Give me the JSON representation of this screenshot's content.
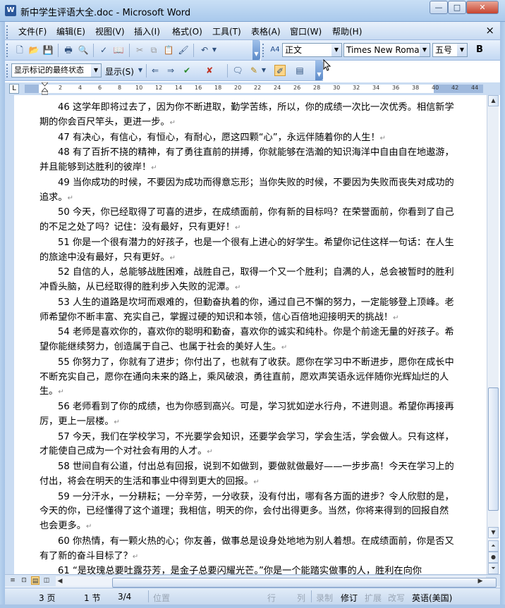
{
  "window": {
    "title": "新中学生评语大全.doc - Microsoft Word",
    "app_icon": "W",
    "minimize": "—",
    "maximize": "□",
    "close": "✕"
  },
  "menubar": {
    "items": [
      "文件(F)",
      "编辑(E)",
      "视图(V)",
      "插入(I)",
      "格式(O)",
      "工具(T)",
      "表格(A)",
      "窗口(W)",
      "帮助(H)"
    ],
    "close_doc": "×"
  },
  "toolbar_standard": {
    "icons": [
      "new-icon",
      "open-icon",
      "save-icon",
      "print-icon",
      "print-preview-icon",
      "spelling-icon",
      "research-icon",
      "cut-icon",
      "copy-icon",
      "paste-icon",
      "format-painter-icon",
      "undo-icon"
    ],
    "style_label_icon": "A4",
    "style_value": "正文",
    "font_value": "Times New Roman",
    "size_value": "五号",
    "bold": "B"
  },
  "toolbar_review": {
    "markup_value": "显示标记的最终状态",
    "show_label": "显示(S)"
  },
  "ruler": {
    "corner": "L",
    "ticks": [
      "2",
      "4",
      "6",
      "8",
      "10",
      "12",
      "14",
      "16",
      "18",
      "20",
      "22",
      "24",
      "26",
      "28",
      "30",
      "32",
      "34",
      "36",
      "38",
      "40",
      "42",
      "44"
    ]
  },
  "document": {
    "paragraphs": [
      "46 这学年即将过去了，因为你不断进取，勤学苦练，所以，你的成绩一次比一次优秀。相信新学期的你会百尺竿头，更进一步。",
      "47 有决心，有信心，有恒心，有耐心，愿这四颗“心”，永远伴随着你的人生！",
      "48 有了百折不挠的精神，有了勇往直前的拼搏，你就能够在浩瀚的知识海洋中自由自在地遨游，并且能够到达胜利的彼岸！",
      "49 当你成功的时候，不要因为成功而得意忘形；当你失败的时候，不要因为失败而丧失对成功的追求。",
      "50 今天，你已经取得了可喜的进步，在成绩面前，你有新的目标吗？在荣誉面前，你看到了自己的不足之处了吗？记住：没有最好，只有更好！",
      "51 你是一个很有潜力的好孩子，也是一个很有上进心的好学生。希望你记住这样一句话：在人生的旅途中没有最好，只有更好。",
      "52 自信的人，总能够战胜困难，战胜自己，取得一个又一个胜利；自满的人，总会被暂时的胜利冲昏头脑，从已经取得的胜利步入失败的泥潭。",
      "53 人生的道路是坎坷而艰难的，但勤奋执着的你，通过自己不懈的努力，一定能够登上顶峰。老师希望你不断丰富、充实自己，掌握过硬的知识和本领，信心百倍地迎接明天的挑战！",
      "54 老师是喜欢你的，喜欢你的聪明和勤奋，喜欢你的诚实和纯朴。你是个前途无量的好孩子。希望你能继续努力，创造属于自己、也属于社会的美好人生。",
      "55 你努力了，你就有了进步；你付出了，也就有了收获。愿你在学习中不断进步，愿你在成长中不断充实自己，愿你在通向未来的路上，乘风破浪，勇往直前，愿欢声笑语永远伴随你光辉灿烂的人生。",
      "56 老师看到了你的成绩，也为你感到高兴。可是，学习犹如逆水行舟，不进则退。希望你再接再厉，更上一层楼。",
      "57 今天，我们在学校学习，不光要学会知识，还要学会学习，学会生活，学会做人。只有这样，才能使自己成为一个对社会有用的人才。",
      "58 世间自有公道，付出总有回报，说到不如做到，要做就做最好——一步步高！今天在学习上的付出，将会在明天的生活和事业中得到更大的回报。",
      "59 一分汗水，一分耕耘；一分辛劳，一分收获，没有付出，哪有各方面的进步？令人欣慰的是，今天的你，已经懂得了这个道理；我相信，明天的你，会付出得更多。当然，你将来得到的回报自然也会更多。",
      "60 你热情，有一颗火热的心；你友善，做事总是设身处地地为别人着想。在成绩面前，你是否又有了新的奋斗目标了？",
      "61 “是玫瑰总要吐露芬芳，是金子总要闪耀光芒。”你是一个能踏实做事的人，胜利在向你"
    ],
    "para_mark": "↵"
  },
  "statusbar": {
    "page": "3 页",
    "section": "1 节",
    "page_of": "3/4",
    "position": "位置",
    "line": "行",
    "column": "列",
    "rec": "录制",
    "trk": "修订",
    "ext": "扩展",
    "ovr": "改写",
    "language": "英语(美国)"
  }
}
